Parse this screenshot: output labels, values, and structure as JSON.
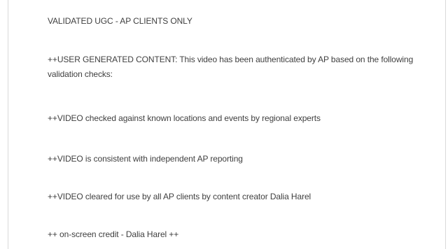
{
  "document": {
    "heading": "VALIDATED UGC - AP CLIENTS ONLY",
    "paragraphs": [
      "++USER GENERATED CONTENT: This video has been authenticated by AP based on the following validation checks:",
      "++VIDEO checked against known locations and events by regional experts",
      "++VIDEO is consistent with independent AP reporting",
      "++VIDEO cleared for use by all AP clients by content creator Dalia Harel",
      "++ on-screen credit - Dalia Harel ++"
    ]
  }
}
